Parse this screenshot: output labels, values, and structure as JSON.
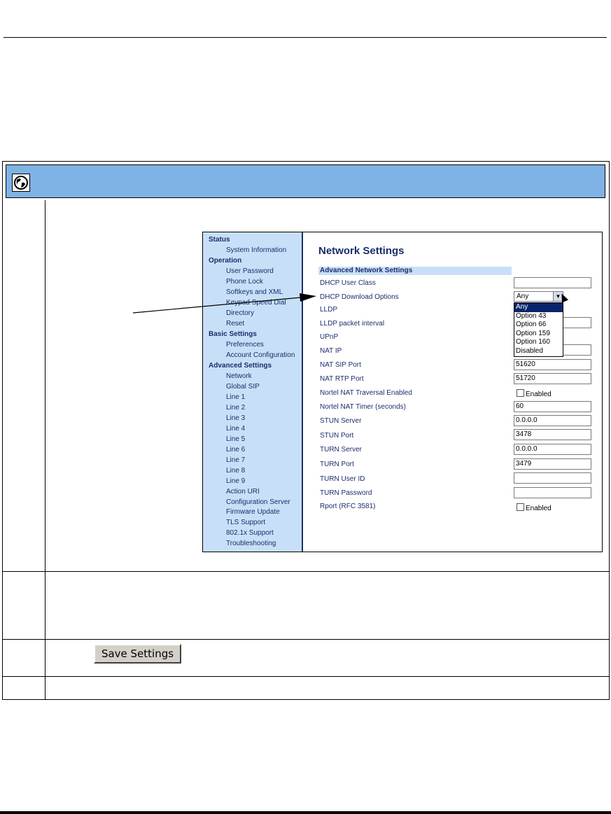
{
  "sidebar": {
    "sections": [
      {
        "title": "Status",
        "items": [
          "System Information"
        ]
      },
      {
        "title": "Operation",
        "items": [
          "User Password",
          "Phone Lock",
          "Softkeys and XML",
          "Keypad Speed Dial",
          "Directory",
          "Reset"
        ]
      },
      {
        "title": "Basic Settings",
        "items": [
          "Preferences",
          "Account Configuration"
        ]
      },
      {
        "title": "Advanced Settings",
        "items": [
          "Network",
          "Global SIP",
          "Line 1",
          "Line 2",
          "Line 3",
          "Line 4",
          "Line 5",
          "Line 6",
          "Line 7",
          "Line 8",
          "Line 9",
          "Action URI",
          "Configuration Server",
          "Firmware Update",
          "TLS Support",
          "802.1x Support",
          "Troubleshooting"
        ]
      }
    ]
  },
  "main": {
    "title": "Network Settings",
    "section": "Advanced Network Settings",
    "fields": [
      {
        "label": "DHCP User Class",
        "value": ""
      },
      {
        "label": "DHCP Download Options",
        "value": "Any"
      },
      {
        "label": "LLDP",
        "value": ""
      },
      {
        "label": "LLDP packet interval",
        "value": ""
      },
      {
        "label": "UPnP",
        "value": ""
      },
      {
        "label": "NAT IP",
        "value": ""
      },
      {
        "label": "NAT SIP Port",
        "value": "51620"
      },
      {
        "label": "NAT RTP Port",
        "value": "51720"
      },
      {
        "label": "Nortel NAT Traversal Enabled",
        "value": "Enabled"
      },
      {
        "label": "Nortel NAT Timer (seconds)",
        "value": "60"
      },
      {
        "label": "STUN Server",
        "value": "0.0.0.0"
      },
      {
        "label": "STUN Port",
        "value": "3478"
      },
      {
        "label": "TURN Server",
        "value": "0.0.0.0"
      },
      {
        "label": "TURN Port",
        "value": "3479"
      },
      {
        "label": "TURN User ID",
        "value": ""
      },
      {
        "label": "TURN Password",
        "value": ""
      },
      {
        "label": "Rport (RFC 3581)",
        "value": "Enabled"
      }
    ],
    "dropdown_options": [
      "Any",
      "Option 43",
      "Option 66",
      "Option 159",
      "Option 160",
      "Disabled"
    ],
    "dropdown_selected": "Any"
  },
  "save_button": "Save Settings"
}
